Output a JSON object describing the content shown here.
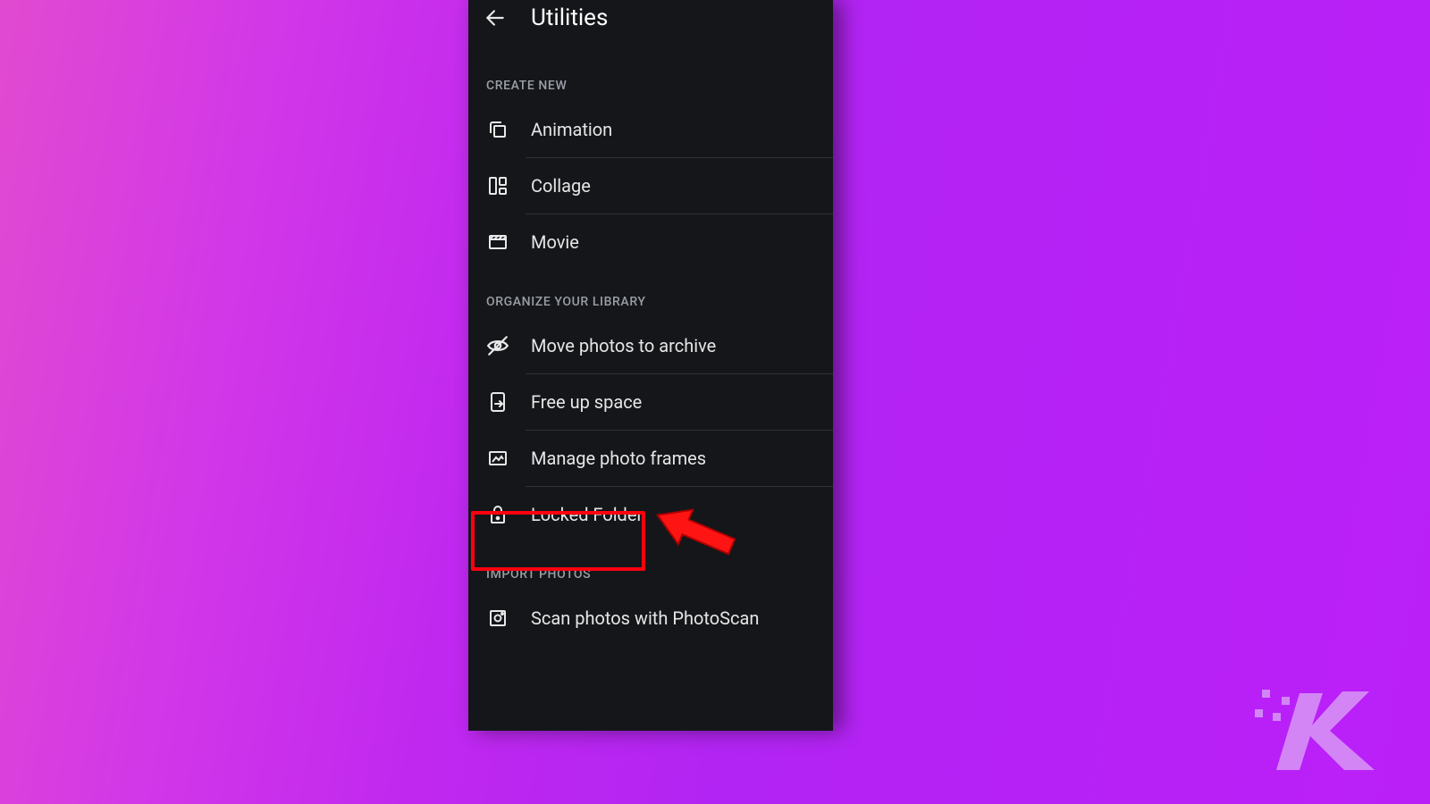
{
  "header": {
    "title": "Utilities"
  },
  "sections": {
    "create": {
      "header": "CREATE NEW",
      "items": {
        "animation": "Animation",
        "collage": "Collage",
        "movie": "Movie"
      }
    },
    "organize": {
      "header": "ORGANIZE YOUR LIBRARY",
      "items": {
        "archive": "Move photos to archive",
        "freeup": "Free up space",
        "frames": "Manage photo frames",
        "locked": "Locked Folder"
      }
    },
    "import": {
      "header": "IMPORT PHOTOS",
      "items": {
        "scan": "Scan photos with PhotoScan"
      }
    }
  },
  "annotation": {
    "highlight_target": "locked-folder-row",
    "highlight_color": "#ff0010"
  }
}
